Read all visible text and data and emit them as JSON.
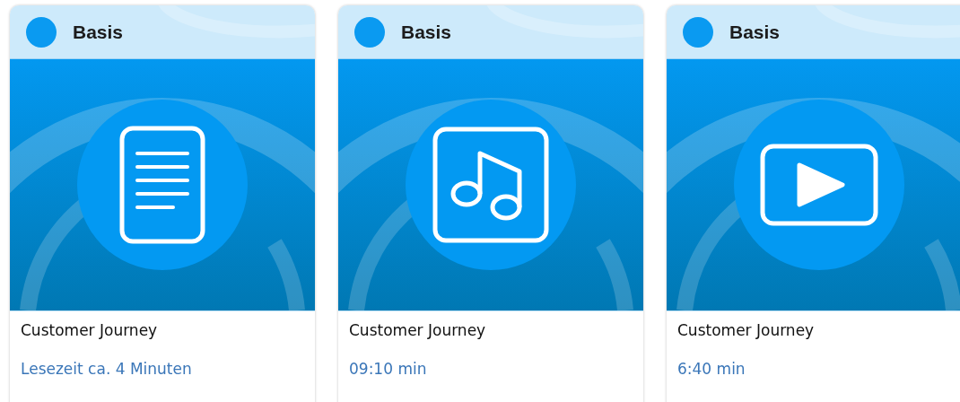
{
  "cards": [
    {
      "level_label": "Basis",
      "kind": "document",
      "title": "Customer Journey",
      "meta": "Lesezeit ca. 4 Minuten"
    },
    {
      "level_label": "Basis",
      "kind": "audio",
      "title": "Customer Journey",
      "meta": "09:10 min"
    },
    {
      "level_label": "Basis",
      "kind": "video",
      "title": "Customer Journey",
      "meta": "6:40 min"
    }
  ]
}
